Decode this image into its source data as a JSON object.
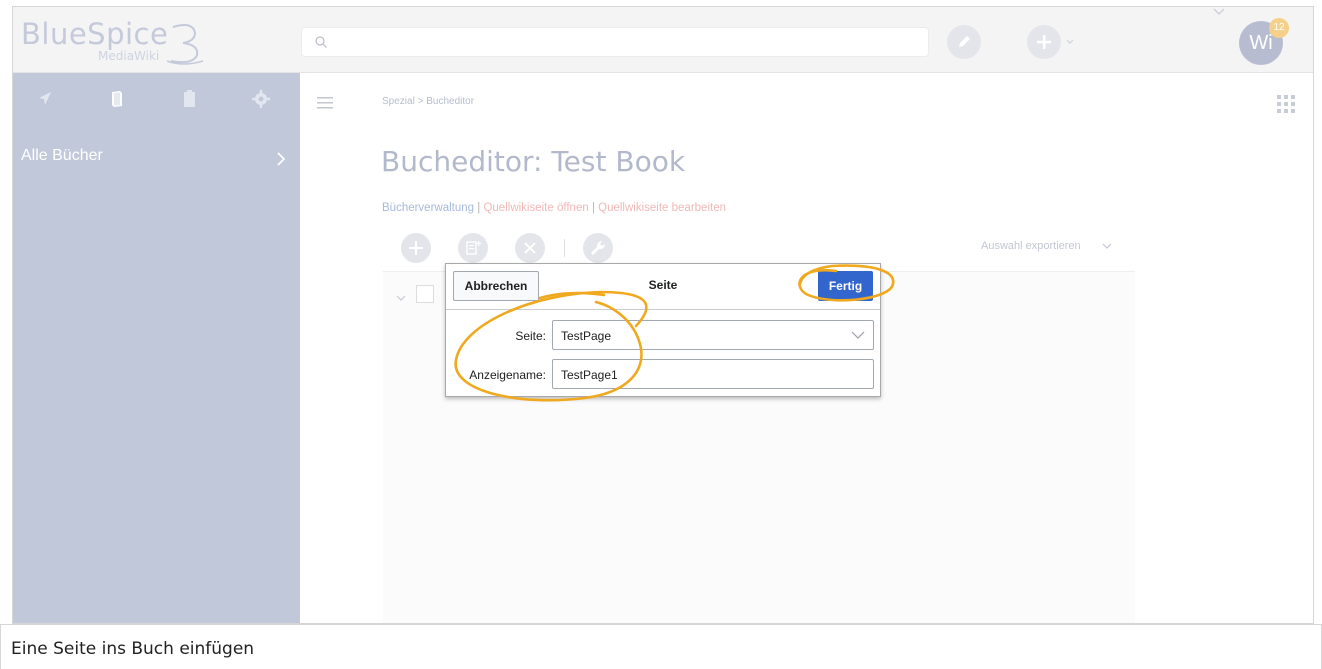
{
  "header": {
    "logo_main": "BlueSpice",
    "logo_sub": "MediaWiki",
    "search": {
      "placeholder": "",
      "icon": "search-icon"
    },
    "avatar_initials": "Wi",
    "notification_count": "12"
  },
  "sidebar": {
    "tabs": [
      {
        "icon": "navigation-arrow-icon"
      },
      {
        "icon": "book-icon"
      },
      {
        "icon": "clipboard-icon"
      },
      {
        "icon": "gear-icon"
      }
    ],
    "items": [
      {
        "label": "Alle Bücher"
      }
    ]
  },
  "breadcrumb": {
    "parent": "Spezial",
    "separator": ">",
    "current": "Bucheditor"
  },
  "page": {
    "title": "Bucheditor: Test Book",
    "links": [
      {
        "label": "Bücherverwaltung",
        "kind": "existing"
      },
      {
        "label": "Quellwikiseite öffnen",
        "kind": "missing"
      },
      {
        "label": "Quellwikiseite bearbeiten",
        "kind": "missing"
      }
    ],
    "link_separator": "|",
    "export_label": "Auswahl exportieren"
  },
  "dialog": {
    "title": "Seite",
    "cancel_label": "Abbrechen",
    "done_label": "Fertig",
    "fields": [
      {
        "label": "Seite:",
        "value": "TestPage",
        "type": "combobox"
      },
      {
        "label": "Anzeigename:",
        "value": "TestPage1",
        "type": "text"
      }
    ]
  },
  "caption": "Eine Seite ins Buch einfügen",
  "colors": {
    "sidebar_bg": "#c1c8da",
    "primary_button": "#3366cc",
    "annotation": "#f0a81e"
  }
}
